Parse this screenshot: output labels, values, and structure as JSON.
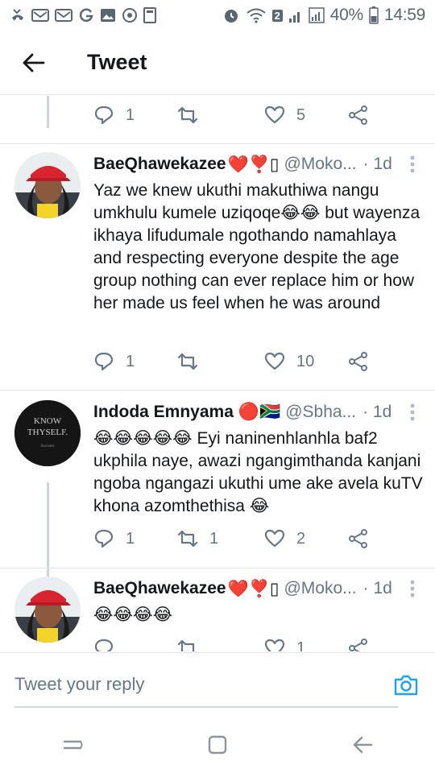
{
  "status_bar": {
    "left_icons": [
      "phone-missed-icon",
      "mail-icon",
      "mail-icon",
      "google-icon",
      "gallery-icon",
      "vpn-icon",
      "news-icon"
    ],
    "right_icons": [
      "alarm-icon",
      "wifi-icon",
      "sim-2-icon",
      "signal-icon",
      "signal-icon",
      "battery-icon"
    ],
    "sim_label": "2",
    "battery": "40%",
    "time": "14:59"
  },
  "header": {
    "title": "Tweet",
    "back_icon": "arrow-left-icon"
  },
  "top_actions": {
    "reply_count": "1",
    "retweet_count": "",
    "like_count": "5"
  },
  "tweets": [
    {
      "name": "BaeQhawekazee",
      "name_emoji": "❤️❣️▯",
      "handle": "@Moko...",
      "time": "· 1d",
      "text": "Yaz we knew ukuthi makuthiwa nangu umkhulu kumele uziqoqe😂😂 but wayenza ikhaya lifudumale ngothando namahlaya and respecting everyone despite the age group nothing can ever replace him or how her made us feel when he was around",
      "reply_count": "1",
      "retweet_count": "",
      "like_count": "10"
    },
    {
      "name": "Indoda Emnyama",
      "name_emoji": "🔴🇿🇦",
      "handle": "@Sbha...",
      "time": "· 1d",
      "avatar_text_1": "KNOW",
      "avatar_text_2": "THYSELF.",
      "avatar_text_3": "Socrates",
      "text": "😂😂😂😂😂 Eyi naninenhlanhla baf2 ukphila naye, awazi ngangimthanda kanjani ngoba ngangazi ukuthi ume ake avela kuTV khona azomthethisa 😂",
      "reply_count": "1",
      "retweet_count": "1",
      "like_count": "2"
    },
    {
      "name": "BaeQhawekazee",
      "name_emoji": "❤️❣️▯",
      "handle": "@Moko...",
      "time": "· 1d",
      "text": "😂😂😂😂",
      "reply_count": "",
      "retweet_count": "",
      "like_count": "1"
    }
  ],
  "reply_bar": {
    "placeholder": "Tweet your reply",
    "camera_icon": "camera-icon"
  },
  "nav_bar": {
    "icons": [
      "recent-apps-icon",
      "home-icon",
      "back-icon"
    ]
  },
  "colors": {
    "accent": "#1da1f2",
    "muted": "#657786",
    "divider": "#e1e8ed"
  }
}
